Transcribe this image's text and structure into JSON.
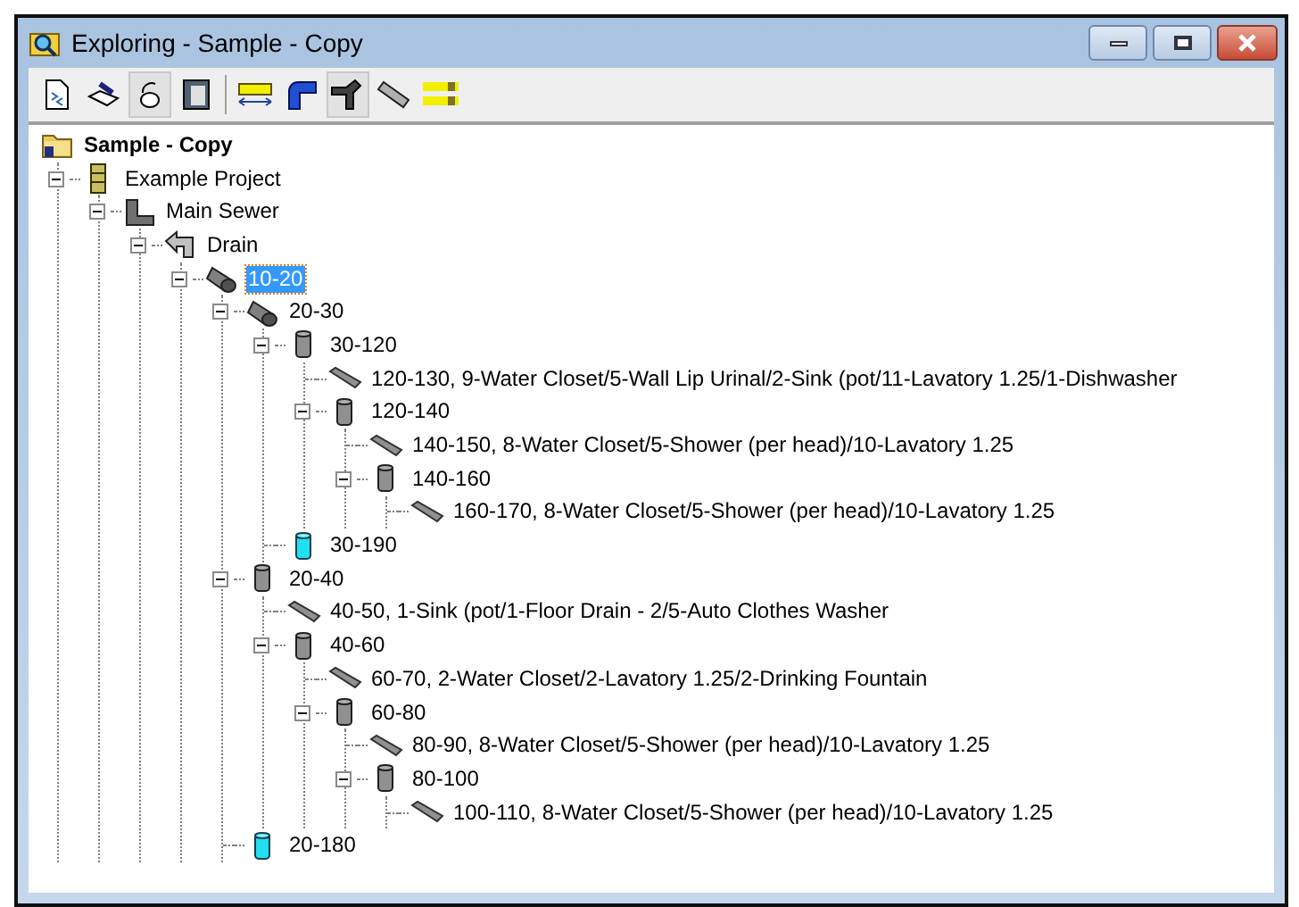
{
  "window": {
    "title": "Exploring - Sample - Copy"
  },
  "toolbar": [
    {
      "kind": "page",
      "pressed": false
    },
    {
      "kind": "edit",
      "pressed": false
    },
    {
      "kind": "rotate",
      "pressed": true
    },
    {
      "kind": "panel",
      "pressed": false
    },
    {
      "kind": "length",
      "pressed": false
    },
    {
      "kind": "elbow",
      "pressed": false
    },
    {
      "kind": "tee",
      "pressed": true
    },
    {
      "kind": "pipe",
      "pressed": false
    },
    {
      "kind": "bars",
      "pressed": false
    }
  ],
  "tree": {
    "label": "Sample - Copy",
    "kind": "root",
    "children": [
      {
        "label": "Example Project",
        "kind": "project",
        "expanded": true,
        "selected": false,
        "children": [
          {
            "label": "Main Sewer",
            "kind": "sewer",
            "expanded": true,
            "selected": false,
            "children": [
              {
                "label": "Drain",
                "kind": "drain",
                "expanded": true,
                "selected": false,
                "children": [
                  {
                    "label": "10-20",
                    "kind": "pipe",
                    "expanded": true,
                    "selected": true,
                    "children": [
                      {
                        "label": "20-30",
                        "kind": "pipe",
                        "expanded": true,
                        "selected": false,
                        "children": [
                          {
                            "label": "30-120",
                            "kind": "riser",
                            "expanded": true,
                            "selected": false,
                            "children": [
                              {
                                "label": "120-130, 9-Water Closet/5-Wall Lip Urinal/2-Sink (pot/11-Lavatory 1.25/1-Dishwasher",
                                "kind": "fixture",
                                "selected": false
                              },
                              {
                                "label": "120-140",
                                "kind": "riser",
                                "expanded": true,
                                "selected": false,
                                "children": [
                                  {
                                    "label": "140-150, 8-Water Closet/5-Shower (per head)/10-Lavatory 1.25",
                                    "kind": "fixture",
                                    "selected": false
                                  },
                                  {
                                    "label": "140-160",
                                    "kind": "riser",
                                    "expanded": true,
                                    "selected": false,
                                    "children": [
                                      {
                                        "label": "160-170, 8-Water Closet/5-Shower (per head)/10-Lavatory 1.25",
                                        "kind": "fixture",
                                        "selected": false
                                      }
                                    ]
                                  }
                                ]
                              }
                            ]
                          },
                          {
                            "label": "30-190",
                            "kind": "stack",
                            "selected": false
                          }
                        ]
                      },
                      {
                        "label": "20-40",
                        "kind": "riser",
                        "expanded": true,
                        "selected": false,
                        "children": [
                          {
                            "label": "40-50, 1-Sink (pot/1-Floor Drain - 2/5-Auto Clothes Washer",
                            "kind": "fixture",
                            "selected": false
                          },
                          {
                            "label": "40-60",
                            "kind": "riser",
                            "expanded": true,
                            "selected": false,
                            "children": [
                              {
                                "label": "60-70, 2-Water Closet/2-Lavatory 1.25/2-Drinking Fountain",
                                "kind": "fixture",
                                "selected": false
                              },
                              {
                                "label": "60-80",
                                "kind": "riser",
                                "expanded": true,
                                "selected": false,
                                "children": [
                                  {
                                    "label": "80-90, 8-Water Closet/5-Shower (per head)/10-Lavatory 1.25",
                                    "kind": "fixture",
                                    "selected": false
                                  },
                                  {
                                    "label": "80-100",
                                    "kind": "riser",
                                    "expanded": true,
                                    "selected": false,
                                    "children": [
                                      {
                                        "label": "100-110, 8-Water Closet/5-Shower (per head)/10-Lavatory 1.25",
                                        "kind": "fixture",
                                        "selected": false
                                      }
                                    ]
                                  }
                                ]
                              }
                            ]
                          }
                        ]
                      },
                      {
                        "label": "20-180",
                        "kind": "stack",
                        "selected": false
                      }
                    ]
                  }
                ]
              }
            ]
          }
        ]
      }
    ]
  }
}
